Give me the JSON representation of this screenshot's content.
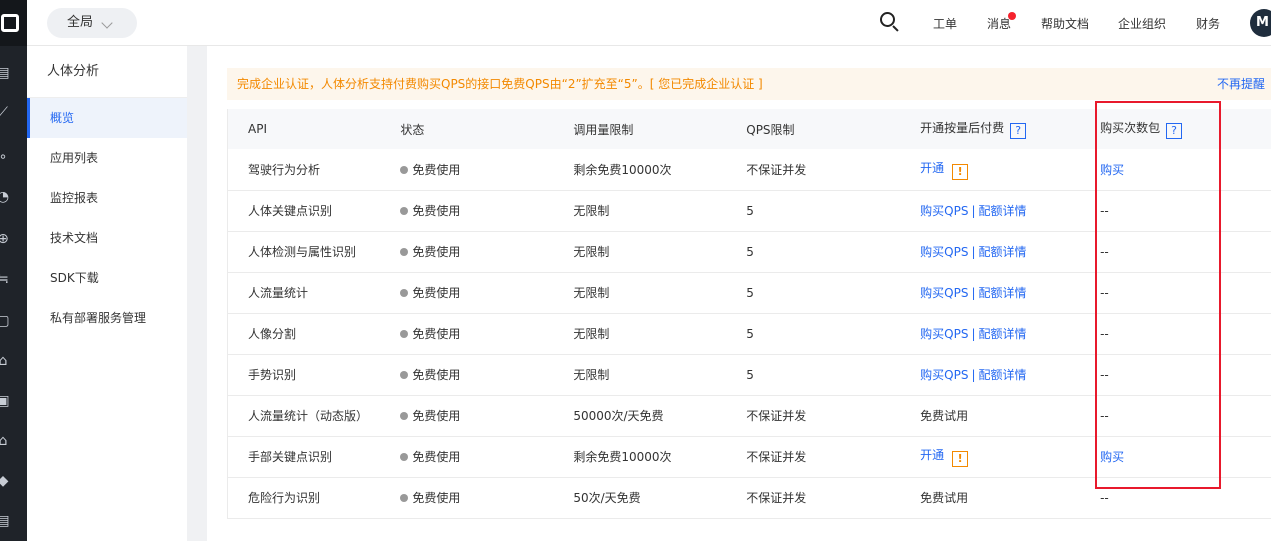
{
  "topbar": {
    "scope": "全局",
    "nav": [
      "工单",
      "消息",
      "帮助文档",
      "企业组织",
      "财务"
    ],
    "avatar": "M"
  },
  "sidebar": {
    "title": "人体分析",
    "items": [
      {
        "label": "概览",
        "active": true
      },
      {
        "label": "应用列表"
      },
      {
        "label": "监控报表"
      },
      {
        "label": "技术文档"
      },
      {
        "label": "SDK下载"
      },
      {
        "label": "私有部署服务管理"
      }
    ]
  },
  "notice": {
    "text": "完成企业认证，人体分析支持付费购买QPS的接口免费QPS由“2”扩充至“5”。[ 您已完成企业认证 ]",
    "dismiss": "不再提醒"
  },
  "table": {
    "headers": [
      "API",
      "状态",
      "调用量限制",
      "QPS限制",
      "开通按量后付费",
      "购买次数包"
    ],
    "help_icon": "?",
    "rows": [
      {
        "api": "驾驶行为分析",
        "status": "免费使用",
        "limit": "剩余免费10000次",
        "qps": "不保证并发",
        "postpaid": "开通",
        "postpaid_warn": true,
        "pack": "购买"
      },
      {
        "api": "人体关键点识别",
        "status": "免费使用",
        "limit": "无限制",
        "qps": "5",
        "postpaid_a": "购买QPS",
        "postpaid_b": "配额详情",
        "pack": "--"
      },
      {
        "api": "人体检测与属性识别",
        "status": "免费使用",
        "limit": "无限制",
        "qps": "5",
        "postpaid_a": "购买QPS",
        "postpaid_b": "配额详情",
        "pack": "--"
      },
      {
        "api": "人流量统计",
        "status": "免费使用",
        "limit": "无限制",
        "qps": "5",
        "postpaid_a": "购买QPS",
        "postpaid_b": "配额详情",
        "pack": "--"
      },
      {
        "api": "人像分割",
        "status": "免费使用",
        "limit": "无限制",
        "qps": "5",
        "postpaid_a": "购买QPS",
        "postpaid_b": "配额详情",
        "pack": "--"
      },
      {
        "api": "手势识别",
        "status": "免费使用",
        "limit": "无限制",
        "qps": "5",
        "postpaid_a": "购买QPS",
        "postpaid_b": "配额详情",
        "pack": "--"
      },
      {
        "api": "人流量统计（动态版）",
        "status": "免费使用",
        "limit": "50000次/天免费",
        "qps": "不保证并发",
        "postpaid_plain": "免费试用",
        "pack": "--"
      },
      {
        "api": "手部关键点识别",
        "status": "免费使用",
        "limit": "剩余免费10000次",
        "qps": "不保证并发",
        "postpaid": "开通",
        "postpaid_warn": true,
        "pack": "购买"
      },
      {
        "api": "危险行为识别",
        "status": "免费使用",
        "limit": "50次/天免费",
        "qps": "不保证并发",
        "postpaid_plain": "免费试用",
        "pack": "--"
      }
    ]
  }
}
